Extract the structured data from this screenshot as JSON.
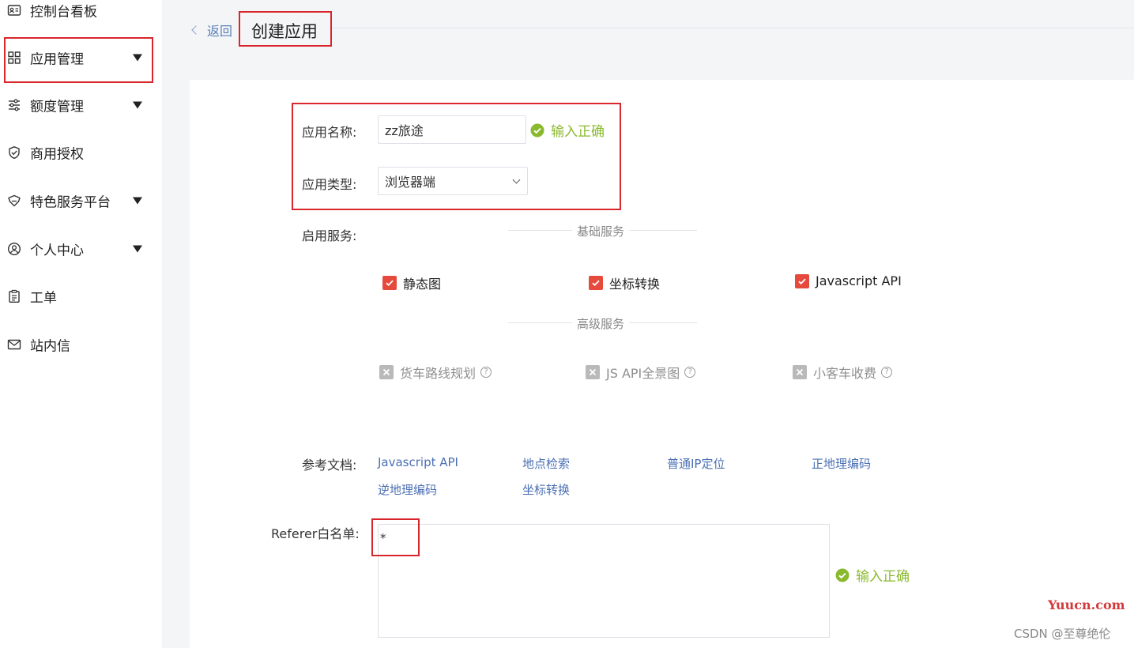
{
  "sidebar": {
    "items": [
      {
        "label": "控制台看板",
        "icon": "id-card-icon",
        "caret": false
      },
      {
        "label": "应用管理",
        "icon": "grid-icon",
        "caret": true
      },
      {
        "label": "额度管理",
        "icon": "sliders-icon",
        "caret": true
      },
      {
        "label": "商用授权",
        "icon": "shield-check-icon",
        "caret": false
      },
      {
        "label": "特色服务平台",
        "icon": "gem-icon",
        "caret": true
      },
      {
        "label": "个人中心",
        "icon": "user-circle-icon",
        "caret": true
      },
      {
        "label": "工单",
        "icon": "clipboard-icon",
        "caret": false
      },
      {
        "label": "站内信",
        "icon": "mail-icon",
        "caret": false
      }
    ]
  },
  "header": {
    "back_label": "返回",
    "title": "创建应用"
  },
  "form": {
    "app_name_label": "应用名称:",
    "app_name_value": "zz旅途",
    "app_name_status": "输入正确",
    "app_type_label": "应用类型:",
    "app_type_value": "浏览器端",
    "services_label": "启用服务:",
    "basic_services_title": "基础服务",
    "basic_services": [
      "静态图",
      "坐标转换",
      "Javascript API"
    ],
    "advanced_services_title": "高级服务",
    "advanced_services": [
      "货车路线规划",
      "JS API全景图",
      "小客车收费"
    ],
    "docs_label": "参考文档:",
    "docs": [
      "Javascript API",
      "地点检索",
      "普通IP定位",
      "正地理编码",
      "逆地理编码",
      "坐标转换"
    ],
    "referer_label": "Referer白名单:",
    "referer_value": "*",
    "referer_status": "输入正确"
  },
  "watermarks": {
    "site": "Yuucn.com",
    "author": "CSDN @至尊绝伦"
  },
  "colors": {
    "accent_red": "#d9262c",
    "checkbox_red": "#e54a3c",
    "success_green": "#8ab92d",
    "link_blue": "#4a6fb3"
  }
}
